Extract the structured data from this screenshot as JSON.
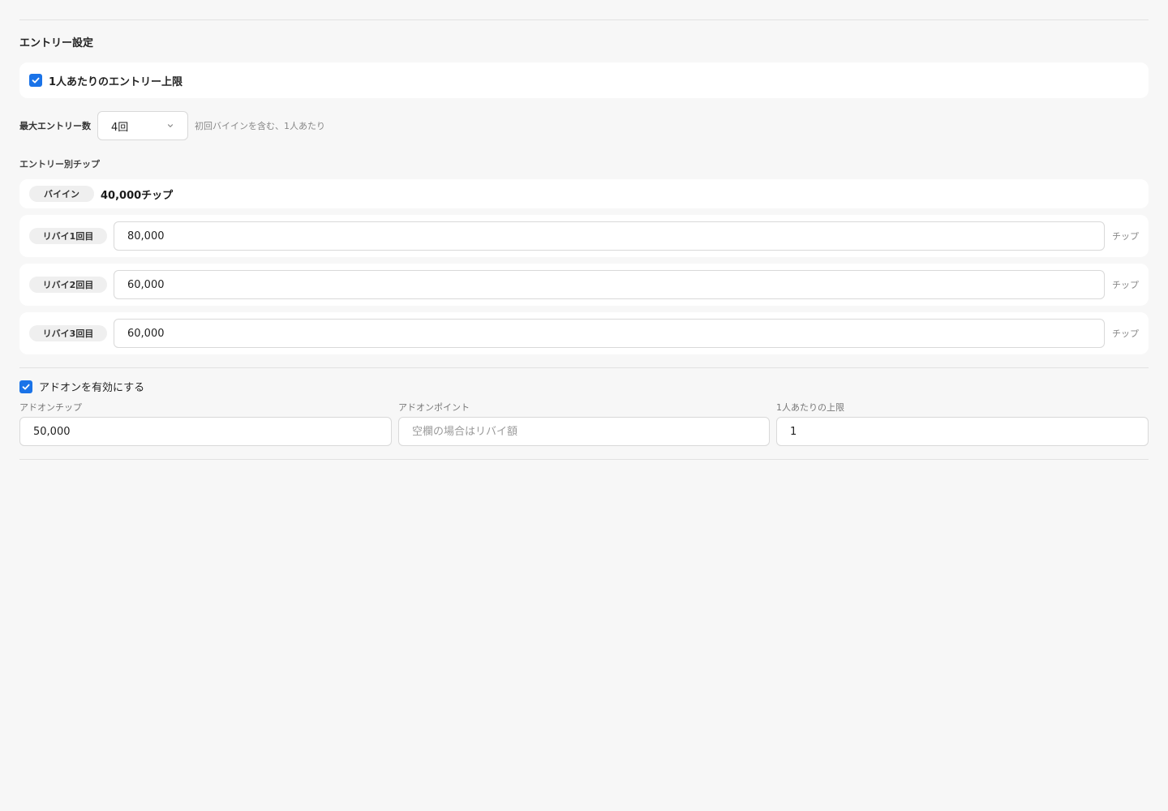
{
  "entry_settings": {
    "title": "エントリー設定",
    "per_person_limit": {
      "label": "1人あたりのエントリー上限",
      "checked": true
    },
    "max_entries": {
      "label": "最大エントリー数",
      "selected": "4回",
      "hint": "初回バイインを含む、1人あたり"
    },
    "chips_section_label": "エントリー別チップ",
    "buyin": {
      "label": "バイイン",
      "value": "40,000チップ"
    },
    "rebuys": [
      {
        "label": "リバイ1回目",
        "value": "80,000",
        "unit": "チップ"
      },
      {
        "label": "リバイ2回目",
        "value": "60,000",
        "unit": "チップ"
      },
      {
        "label": "リバイ3回目",
        "value": "60,000",
        "unit": "チップ"
      }
    ]
  },
  "addon": {
    "enable": {
      "label": "アドオンを有効にする",
      "checked": true
    },
    "chips": {
      "label": "アドオンチップ",
      "value": "50,000",
      "placeholder": ""
    },
    "points": {
      "label": "アドオンポイント",
      "value": "",
      "placeholder": "空欄の場合はリバイ額"
    },
    "per_person_limit": {
      "label": "1人あたりの上限",
      "value": "1",
      "placeholder": ""
    }
  },
  "colors": {
    "accent": "#1a73e8",
    "background": "#f7f7f7",
    "card": "#ffffff"
  },
  "icons": {
    "checkbox": "check-icon",
    "select": "chevron-down-icon"
  }
}
